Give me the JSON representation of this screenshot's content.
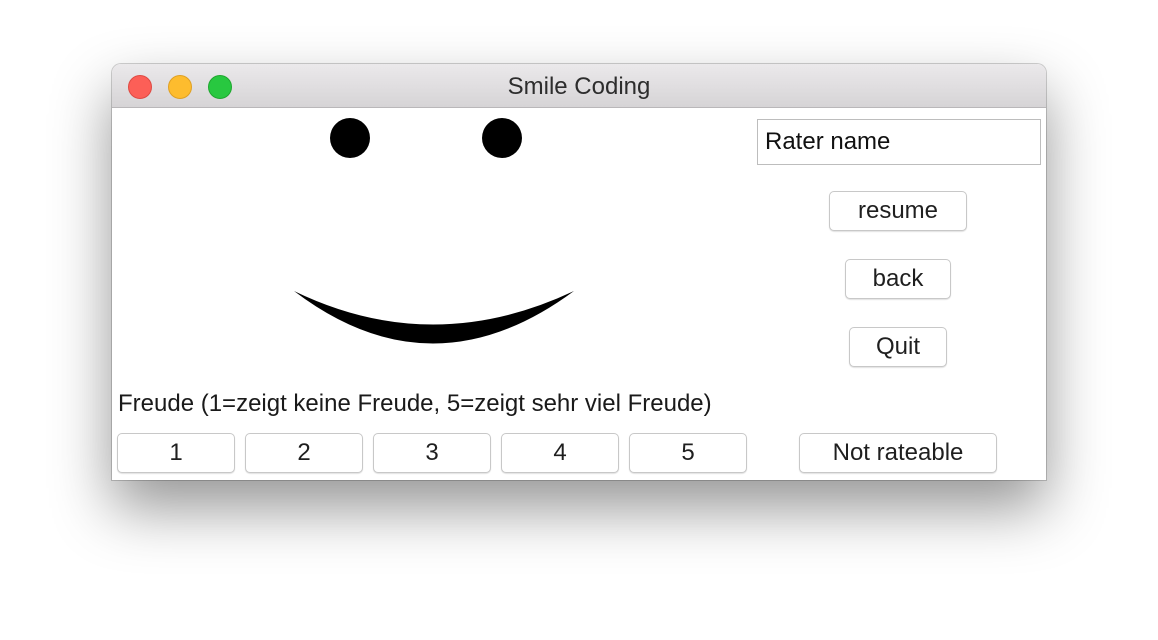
{
  "window": {
    "title": "Smile Coding"
  },
  "stimulus": {
    "description_icon": "smiley-face",
    "color": "#000000"
  },
  "rater": {
    "value": "Rater name"
  },
  "controls": {
    "resume_label": "resume",
    "back_label": "back",
    "quit_label": "Quit"
  },
  "question": {
    "text": "Freude (1=zeigt keine Freude, 5=zeigt sehr viel Freude)"
  },
  "ratings": {
    "options": [
      "1",
      "2",
      "3",
      "4",
      "5"
    ],
    "not_rateable_label": "Not rateable"
  }
}
